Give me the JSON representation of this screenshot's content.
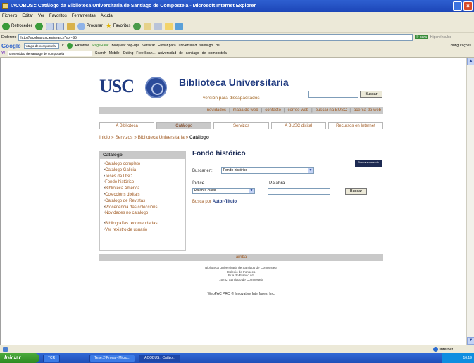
{
  "window": {
    "title": "IACOBUS:: Catálogo da Biblioteca Universitaria de Santiago de Compostela - Microsoft Internet Explorer"
  },
  "menu": [
    "Ficheiro",
    "Editar",
    "Ver",
    "Favoritos",
    "Ferramentas",
    "Axuda"
  ],
  "toolbar": {
    "back": "Retroceder",
    "search": "Procurar",
    "favorites": "Favoritos"
  },
  "address": {
    "label": "Enderezo",
    "url": "http://iacobus.usc.es/search*spi~S5",
    "go": "Ir para",
    "links": "Hipervínculos"
  },
  "google_bar": {
    "logo": "Google",
    "query": "•ntago de compostela",
    "go": "Ir",
    "favorites": "Favoritos",
    "pagerank": "PageRank",
    "popup": "Bloquear pop-ups",
    "spell": "Verificar",
    "send": "Enviar para",
    "terms": [
      "universidad",
      "santiago",
      "de"
    ],
    "settings": "Configurações"
  },
  "links_bar": {
    "query": "universidad de santiago de compostela",
    "search": "Search",
    "mobile": "Mobile!",
    "dating": "Dating",
    "free_scan": "Free Scan...",
    "terms": [
      "universidad",
      "de",
      "santiago",
      "de",
      "compostela"
    ]
  },
  "header": {
    "logo_text": "USC",
    "logo_sub": "UNIVERSIDADE DE SANTIAGO DE COMPOSTELA",
    "title": "Biblioteca Universitaria",
    "accessible": "versión para discapacitados",
    "search_button": "Buscar"
  },
  "nav": [
    "novidades",
    "mapa do web",
    "contacto",
    "correo web",
    "buscar na BUSC",
    "acerca do web"
  ],
  "tabs": [
    "A Biblioteca",
    "Catálogo",
    "Servizos",
    "A BUSC dixital",
    "Recursos en Internet"
  ],
  "breadcrumb": {
    "items": [
      "Inicio",
      "Servizos",
      "Biblioteca Universitaria"
    ],
    "current": "Catálogo",
    "sep": "»"
  },
  "sidebar": {
    "heading": "Catálogo",
    "items": [
      "Catálogo completo",
      "Catálogo Galicia",
      "Teses da USC",
      "Fondo histórico",
      "Biblioteca América",
      "Coleccións dixitais",
      "Catálogo de Revistas",
      "Procedencia das coleccións",
      "Novidades no catálogo"
    ],
    "items2": [
      "Bibliografías recomendadas",
      "Ver rexistro de usuario"
    ]
  },
  "search_form": {
    "title": "Fondo histórico",
    "advanced": "Busca avanzada",
    "buscar_en_label": "Buscar en:",
    "buscar_en_value": "Fondo histórico",
    "indice_label": "Índice",
    "indice_value": "Palabra clave",
    "palabra_label": "Palabra",
    "palabra_value": "",
    "buscar_button": "Buscar",
    "autor_prefix": "Busca por",
    "autor_link": "Autor-Título"
  },
  "footer": {
    "arriba": "arriba",
    "lines": [
      "Biblioteca Universitaria de Santiago de Compostela",
      "Colexio de Fonseca",
      "Rúa do Franco s/n",
      "15782 Santiago de Compostela"
    ],
    "webpac": "WebPAC PRO © Innovative Interfaces, Inc."
  },
  "status": {
    "zone": "Internet"
  },
  "taskbar": {
    "start": "Iniciar",
    "tasks": [
      "TCR",
      "Tese:2ªProva - Micro...",
      "IACOBUS:: Catálo..."
    ],
    "clock": "16:19"
  },
  "colors": {
    "link": "#a05a22",
    "brand": "#1f3a80",
    "band": "#c9c9c9"
  }
}
